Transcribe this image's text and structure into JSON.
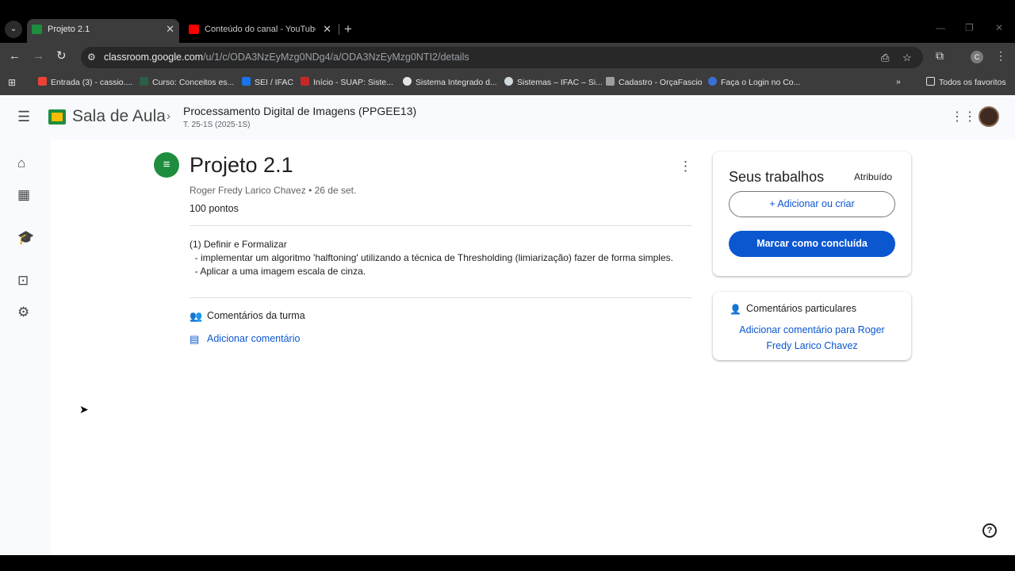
{
  "colors": {
    "accent": "#0b57d0",
    "classroom_green": "#1e8e3e",
    "youtube_red": "#ff0000"
  },
  "browser": {
    "tabs": [
      {
        "title": "Projeto 2.1",
        "icon": "classroom-icon",
        "active": true
      },
      {
        "title": "Conteúdo do canal - YouTube S",
        "icon": "youtube-icon",
        "active": false
      }
    ],
    "url_host": "classroom.google.com",
    "url_path": "/u/1/c/ODA3NzEyMzg0NDg4/a/ODA3NzEyMzg0NTI2/details",
    "profile_initial": "C",
    "bookmarks": [
      "Entrada (3) - cassio....",
      "Curso: Conceitos es...",
      "SEI / IFAC",
      "Início - SUAP: Siste...",
      "Sistema Integrado d...",
      "Sistemas – IFAC – Si...",
      "Cadastro - OrçaFascio",
      "Faça o Login no Co..."
    ],
    "all_bookmarks": "Todos os favoritos"
  },
  "app": {
    "brand": "Sala de Aula",
    "course_title": "Processamento Digital de Imagens (PPGEE13)",
    "course_subtitle": "T. 25-1S (2025-1S)"
  },
  "assignment": {
    "title": "Projeto 2.1",
    "meta": "Roger Fredy Larico Chavez • 26 de set.",
    "points": "100 pontos",
    "description": "(1) Definir e Formalizar\n  - implementar um algoritmo 'halftoning' utilizando a técnica de Thresholding (limiarização) fazer de forma simples.\n  - Aplicar a uma imagem escala de cinza.",
    "class_comments_label": "Comentários da turma",
    "add_comment": "Adicionar comentário"
  },
  "work_panel": {
    "title": "Seus trabalhos",
    "status": "Atribuído",
    "add_or_create": "Adicionar ou criar",
    "mark_done": "Marcar como concluída"
  },
  "private_comments": {
    "title": "Comentários particulares",
    "link": "Adicionar comentário para Roger Fredy Larico Chavez"
  }
}
